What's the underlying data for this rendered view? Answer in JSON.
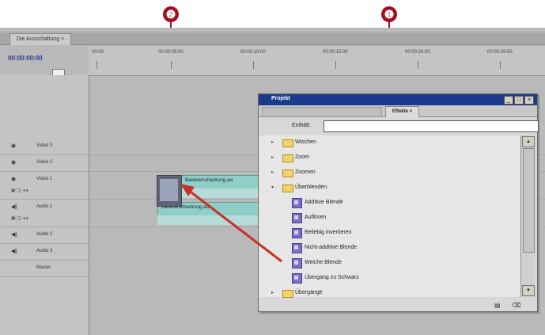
{
  "callouts": {
    "one": "❶",
    "two": "❷"
  },
  "timeline": {
    "tab": "Die Ausschaltung ×",
    "timecode": "00:00:00:00",
    "ruler_labels": [
      "00:00",
      "00:00:05:00",
      "00:00:10:00",
      "00:00:15:00",
      "00:00:20:00",
      "00:00:25:00"
    ],
    "tracks": [
      {
        "name": "Video 3",
        "eye": "◉"
      },
      {
        "name": "Video 2",
        "eye": "◉"
      },
      {
        "name": "Video 1",
        "eye": "◉"
      },
      {
        "name": "Audio 1",
        "eye": "◀)"
      },
      {
        "name": "Audio 2",
        "eye": "◀)"
      },
      {
        "name": "Audio 3",
        "eye": "◀)"
      },
      {
        "name": "Master",
        "eye": ""
      }
    ],
    "video_clip_label": "Bankverschwörung.avi",
    "audio_clip_label": "Bankverschwörung.avi"
  },
  "project_panel": {
    "title": "Projekt",
    "active_tab": "Effekte ×",
    "search_label": "Enthält:",
    "search_value": "",
    "items": [
      {
        "type": "folder",
        "label": "Wischen",
        "expander": "▸"
      },
      {
        "type": "folder",
        "label": "Zoom",
        "expander": "▸"
      },
      {
        "type": "folder",
        "label": "Zoomen",
        "expander": "▸"
      },
      {
        "type": "folder",
        "label": "Überblenden",
        "expander": "▾"
      },
      {
        "type": "effect",
        "label": "Additive Blende"
      },
      {
        "type": "effect",
        "label": "Auflösen"
      },
      {
        "type": "effect",
        "label": "Beliebig invertieren"
      },
      {
        "type": "effect",
        "label": "Nicht-additive Blende"
      },
      {
        "type": "effect",
        "label": "Weiche Blende"
      },
      {
        "type": "effect",
        "label": "Übergang zu Schwarz"
      },
      {
        "type": "folder",
        "label": "Übergänge",
        "expander": "▸"
      }
    ]
  }
}
